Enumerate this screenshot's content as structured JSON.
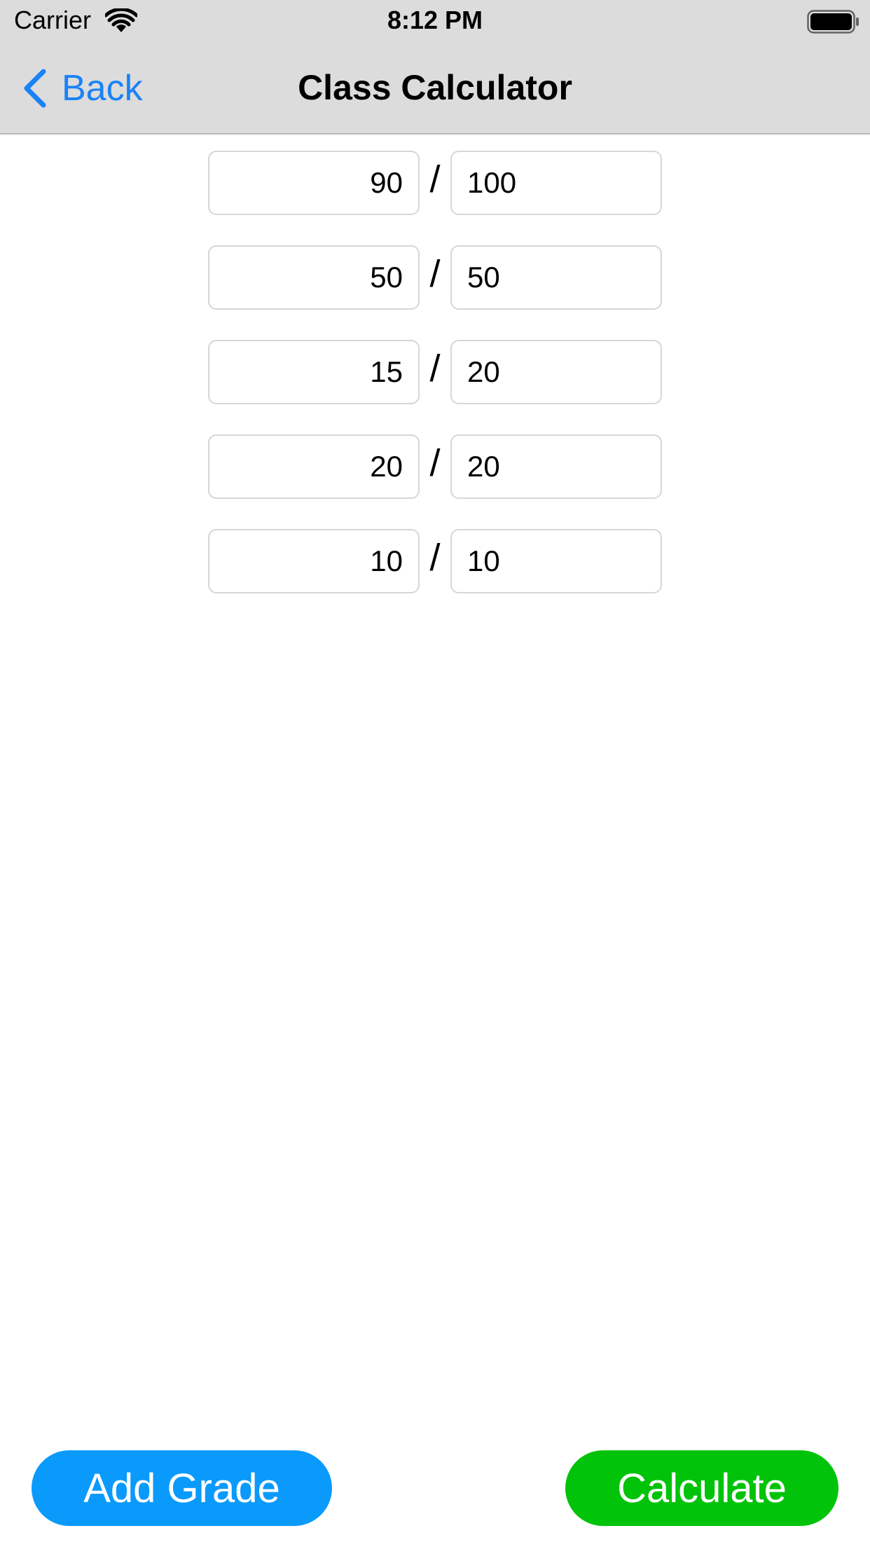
{
  "status_bar": {
    "carrier": "Carrier",
    "time": "8:12 PM",
    "wifi_icon": "wifi-icon",
    "battery_icon": "battery-icon"
  },
  "nav": {
    "back_label": "Back",
    "back_icon": "chevron-left-icon",
    "title": "Class Calculator"
  },
  "grades": [
    {
      "earned": "90",
      "possible": "100"
    },
    {
      "earned": "50",
      "possible": "50"
    },
    {
      "earned": "15",
      "possible": "20"
    },
    {
      "earned": "20",
      "possible": "20"
    },
    {
      "earned": "10",
      "possible": "10"
    }
  ],
  "separator": "/",
  "buttons": {
    "add_grade": "Add Grade",
    "calculate": "Calculate"
  },
  "colors": {
    "accent_blue": "#1a82f7",
    "add_grade_bg": "#0a9afc",
    "calculate_bg": "#00c30a",
    "nav_bg": "#dcdcdc"
  }
}
